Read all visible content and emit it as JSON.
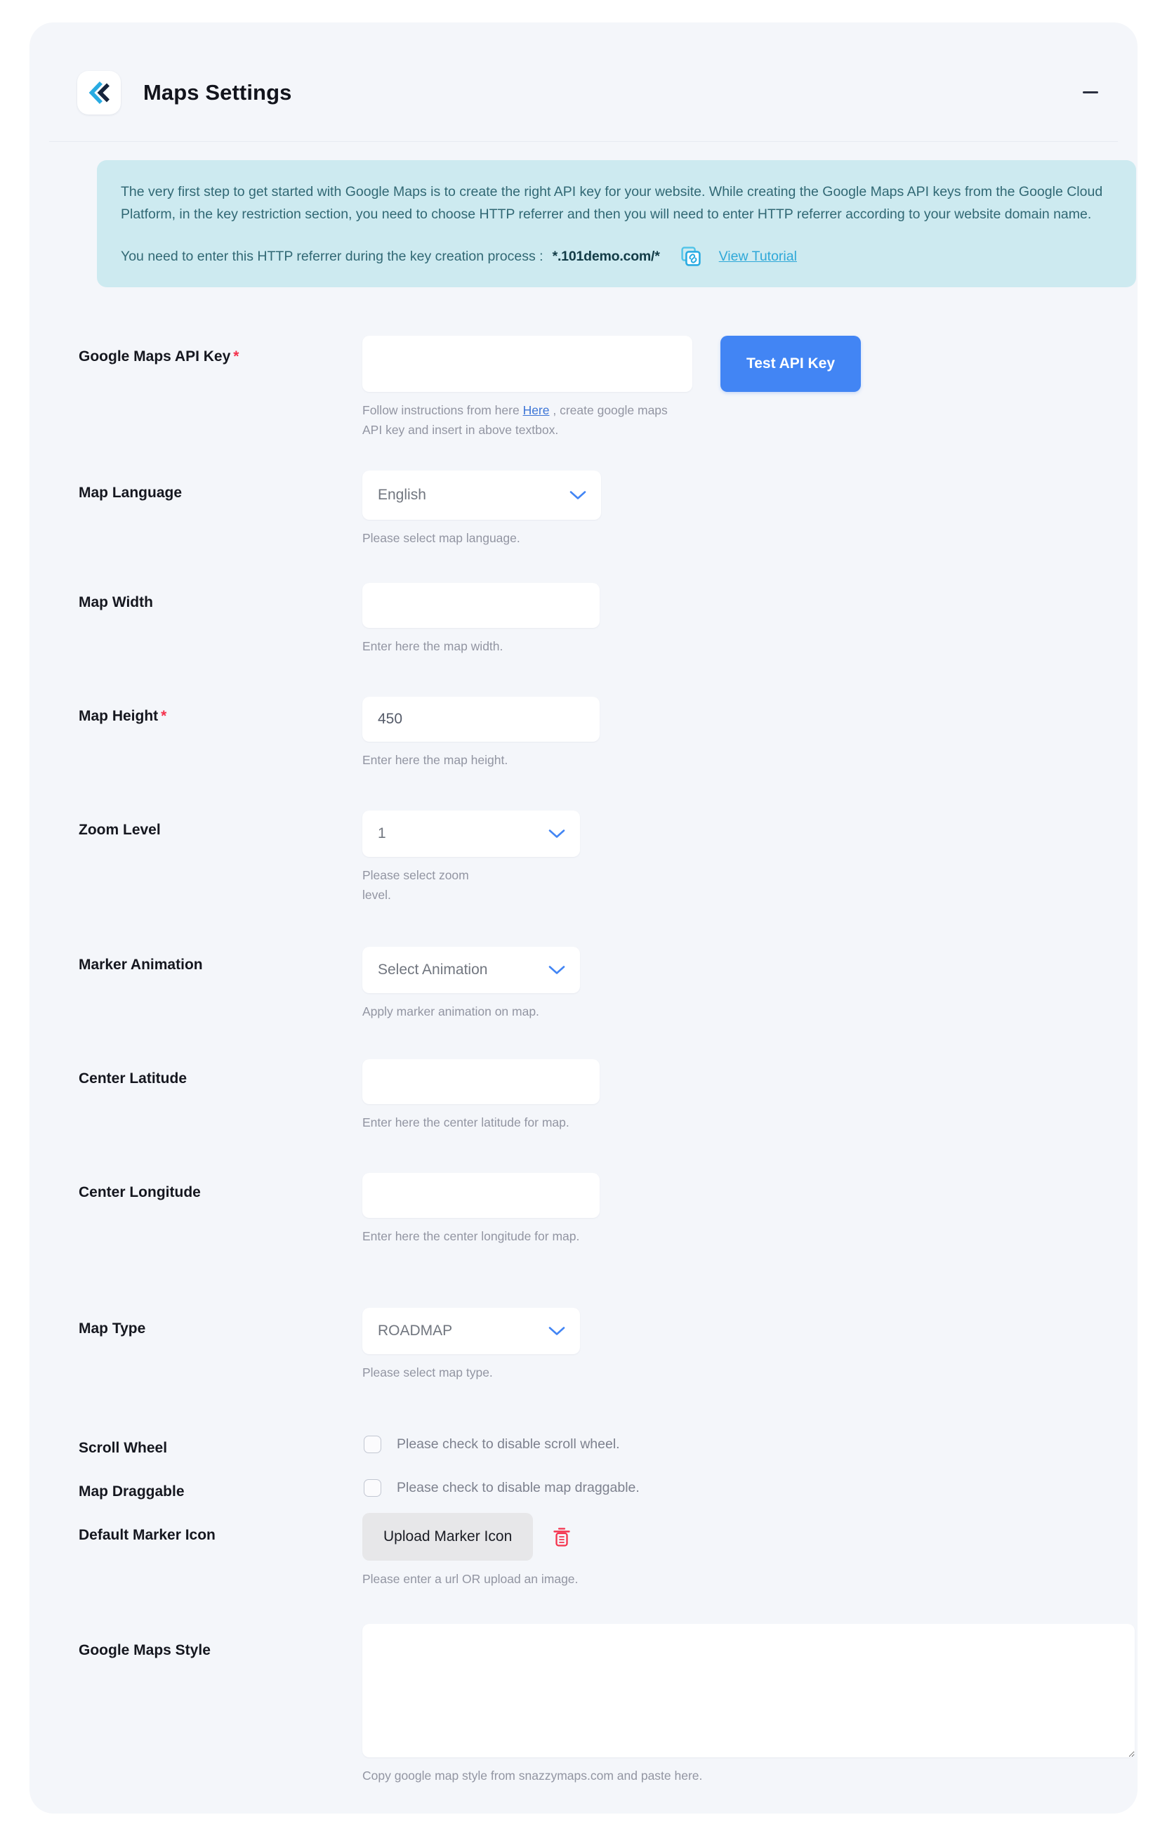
{
  "header": {
    "title": "Maps Settings",
    "logo_icon": "chevron-brand-logo",
    "collapse_label": "–"
  },
  "banner": {
    "paragraph": "The very first step to get started with Google Maps is to create the right API key for your website. While creating the Google Maps API keys from the Google Cloud Platform, in the key restriction section, you need to choose HTTP referrer and then you will need to enter HTTP referrer according to your website domain name.",
    "referrer_label": "You need to enter this HTTP referrer during the key creation process :",
    "referrer_value": "*.101demo.com/*",
    "copy_icon": "copy-link-icon",
    "tutorial_link": "View Tutorial",
    "bg_color": "#cdeaf0",
    "text_color": "#316874"
  },
  "fields": {
    "api_key": {
      "label": "Google Maps API Key",
      "required": true,
      "value": "",
      "placeholder": "",
      "hint_prefix": "Follow instructions from here ",
      "hint_link": "Here",
      "hint_suffix": " , create google maps API key and insert in above textbox.",
      "button_label": "Test API Key",
      "button_color": "#4285f4"
    },
    "map_language": {
      "label": "Map Language",
      "required": false,
      "value": "English",
      "hint": "Please select map language."
    },
    "map_width": {
      "label": "Map Width",
      "required": false,
      "value": "",
      "hint": "Enter here the map width."
    },
    "map_height": {
      "label": "Map Height",
      "required": true,
      "value": "450",
      "hint": "Enter here the map height."
    },
    "zoom_level": {
      "label": "Zoom Level",
      "required": false,
      "value": "1",
      "hint": "Please select zoom level."
    },
    "marker_animation": {
      "label": "Marker Animation",
      "required": false,
      "value": "Select Animation",
      "hint": "Apply marker animation on map."
    },
    "center_latitude": {
      "label": "Center Latitude",
      "required": false,
      "value": "",
      "hint": "Enter here the center latitude for map."
    },
    "center_longitude": {
      "label": "Center Longitude",
      "required": false,
      "value": "",
      "hint": "Enter here the center longitude for map."
    },
    "map_type": {
      "label": "Map Type",
      "required": false,
      "value": "ROADMAP",
      "hint": "Please select map type."
    },
    "scroll_wheel": {
      "label": "Scroll Wheel",
      "checkbox_label": "Please check to disable scroll wheel.",
      "checked": false
    },
    "map_draggable": {
      "label": "Map Draggable",
      "checkbox_label": "Please check to disable map draggable.",
      "checked": false
    },
    "default_marker_icon": {
      "label": "Default Marker Icon",
      "button_label": "Upload Marker Icon",
      "delete_icon": "trash-icon",
      "hint": "Please enter a url OR upload an image."
    },
    "google_maps_style": {
      "label": "Google Maps Style",
      "value": "",
      "placeholder": "",
      "hint": "Copy google map style from snazzymaps.com and paste here."
    }
  },
  "theme": {
    "card_bg": "#f4f6fa",
    "accent": "#4285f4",
    "required_star": "#f4314c",
    "danger": "#f4314c",
    "link": "#3b74d6"
  }
}
